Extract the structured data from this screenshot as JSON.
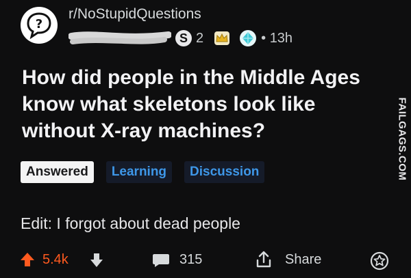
{
  "post": {
    "subreddit": "r/NoStupidQuestions",
    "award_count": "2",
    "timestamp": "13h",
    "title": "How did people in the Middle Ages know what skeletons look like without X-ray machines?",
    "flairs": [
      "Answered",
      "Learning",
      "Discussion"
    ],
    "body": "Edit: I forgot about dead people"
  },
  "actions": {
    "score": "5.4k",
    "comments": "315",
    "share_label": "Share"
  },
  "watermark": "FAILGAGS.COM",
  "colors": {
    "background": "#0e0e0f",
    "upvote": "#ff5a1f",
    "flair_link": "#3e97e8"
  },
  "icons": {
    "subreddit": "question-mark-icon",
    "upvote": "arrow-up-icon",
    "downvote": "arrow-down-icon",
    "comments": "comment-bubble-icon",
    "share": "share-icon",
    "award": "award-icon"
  }
}
